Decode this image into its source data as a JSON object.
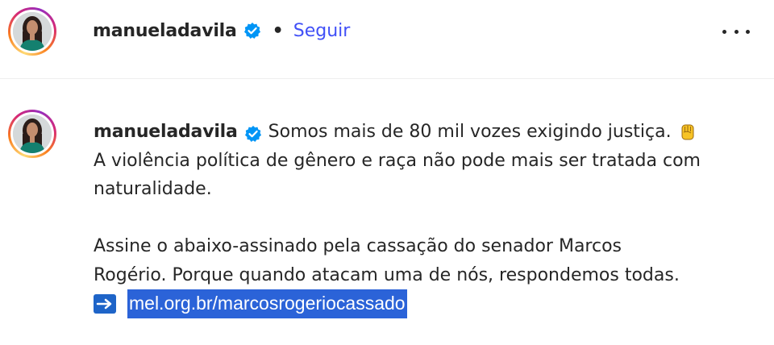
{
  "header": {
    "username": "manueladavila",
    "separator": "•",
    "follow_label": "Seguir",
    "verified_icon": "verified-badge-icon",
    "more_icon": "more-options-icon"
  },
  "caption": {
    "username": "manueladavila",
    "line1": "Somos mais de 80 mil vozes exigindo justiça.",
    "line1_emoji": "raised-fist-icon",
    "line2": "A violência política de gênero e raça não pode mais ser tratada com",
    "line3": "naturalidade.",
    "line4": "Assine o abaixo-assinado pela cassação do senador Marcos",
    "line5": "Rogério. Porque quando atacam uma de nós, respondemos todas.",
    "arrow_icon": "right-arrow-icon",
    "link_text": "mel.org.br/marcosrogeriocassado"
  },
  "colors": {
    "follow": "#4150f7",
    "verified": "#0095f6",
    "link_highlight": "#2b63d8"
  }
}
